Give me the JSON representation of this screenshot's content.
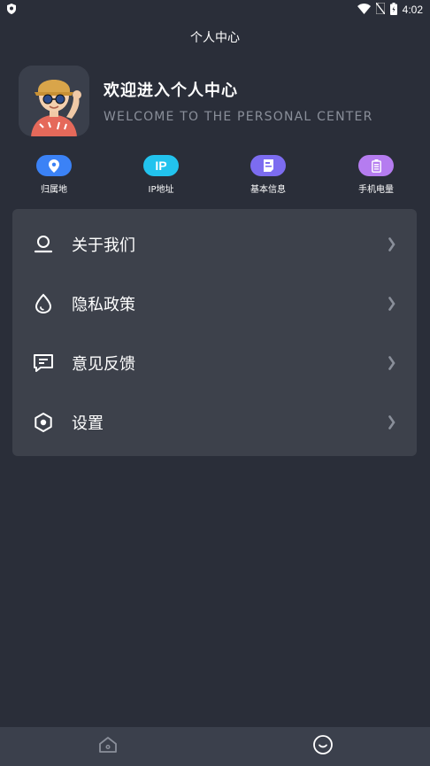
{
  "status_bar": {
    "time": "4:02",
    "icons": [
      "shield-icon",
      "wifi-icon",
      "no-sim-icon",
      "battery-icon"
    ]
  },
  "header": {
    "title": "个人中心"
  },
  "profile": {
    "avatar_icon": "avatar-cartoon-boy",
    "welcome_title": "欢迎进入个人中心",
    "welcome_subtitle": "WELCOME TO THE PERSONAL CENTER"
  },
  "quick_actions": [
    {
      "label": "归属地",
      "icon": "location-pin-icon",
      "color": "#3b82f6"
    },
    {
      "label": "IP地址",
      "icon": "ip-icon",
      "text": "IP",
      "color": "#22c3ee"
    },
    {
      "label": "基本信息",
      "icon": "info-card-icon",
      "color": "#7c6cf0"
    },
    {
      "label": "手机电量",
      "icon": "battery-icon",
      "color": "#b57cf0"
    }
  ],
  "menu": {
    "items": [
      {
        "label": "关于我们",
        "icon": "user-icon"
      },
      {
        "label": "隐私政策",
        "icon": "drop-icon"
      },
      {
        "label": "意见反馈",
        "icon": "feedback-icon"
      },
      {
        "label": "设置",
        "icon": "settings-icon"
      }
    ]
  },
  "bottom_nav": {
    "tabs": [
      {
        "name": "home",
        "icon": "home-icon",
        "active": false
      },
      {
        "name": "profile",
        "icon": "smiley-icon",
        "active": true
      }
    ]
  },
  "colors": {
    "background": "#2a2e39",
    "card": "#3d414b",
    "nav": "#3b404c",
    "subtitle": "#8a8f9a"
  }
}
